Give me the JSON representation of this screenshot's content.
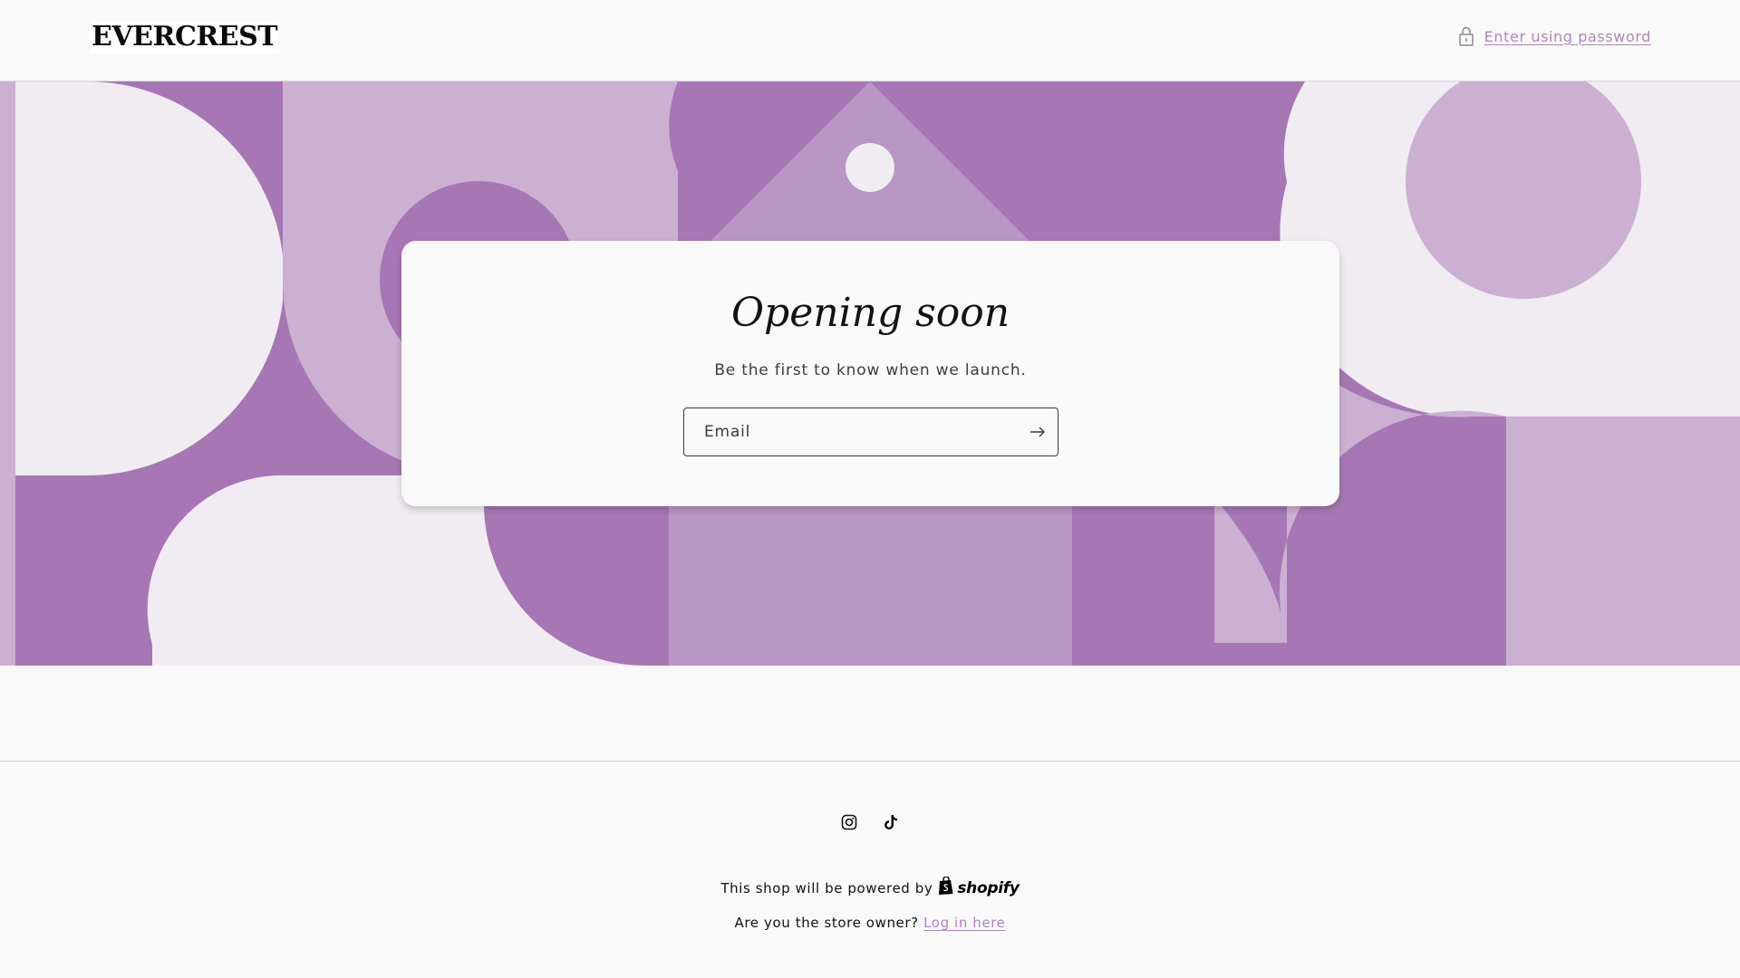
{
  "header": {
    "logo_text": "EVERCREST",
    "password_link": "Enter using password"
  },
  "banner": {
    "colors": {
      "dark": "#a677b4",
      "medium": "#b996c3",
      "light": "#cbb0d2",
      "pale": "#f1ebf2"
    }
  },
  "signup": {
    "title": "Opening soon",
    "subtitle": "Be the first to know when we launch.",
    "email_placeholder": "Email",
    "submit_icon": "arrow-right-icon"
  },
  "footer": {
    "social": [
      {
        "name": "Instagram",
        "icon": "instagram-icon"
      },
      {
        "name": "TikTok",
        "icon": "tiktok-icon"
      }
    ],
    "powered_by_text": "This shop will be powered by",
    "powered_by_brand": "shopify",
    "owner_question": "Are you the store owner?",
    "login_link": "Log in here"
  },
  "colors": {
    "accent": "#b084c0",
    "background": "#f9f9f9",
    "text": "#121212"
  }
}
